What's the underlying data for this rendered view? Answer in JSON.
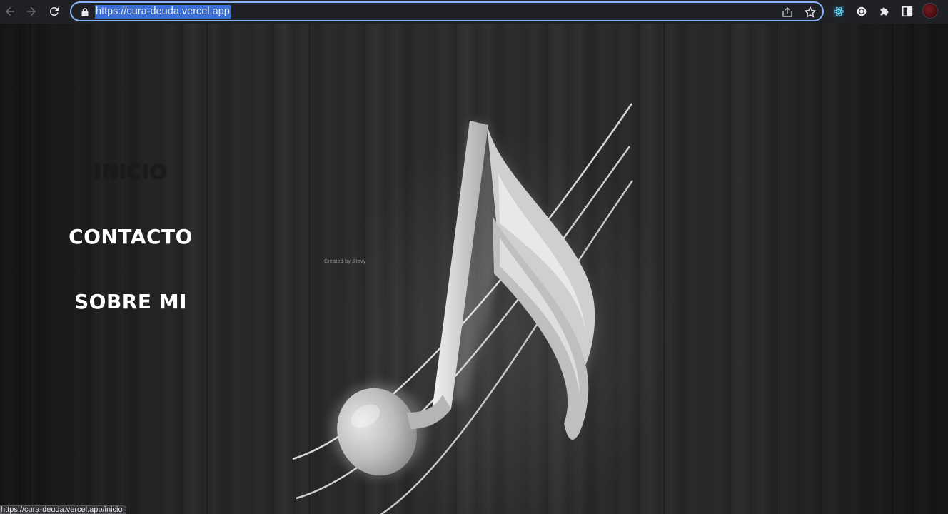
{
  "browser": {
    "url": "https://cura-deuda.vercel.app",
    "status_url": "https://cura-deuda.vercel.app/inicio",
    "accent": "#8ab4f8",
    "icons": [
      "back-icon",
      "forward-icon",
      "reload-icon",
      "lock-icon",
      "share-icon",
      "star-icon",
      "react-devtools-icon",
      "extension-icon",
      "puzzle-icon",
      "side-panel-icon",
      "profile-avatar"
    ]
  },
  "nav": {
    "items": [
      {
        "label": "INICIO",
        "active": true
      },
      {
        "label": "CONTACTO",
        "active": false
      },
      {
        "label": "SOBRE MI",
        "active": false
      }
    ]
  },
  "hero": {
    "credit": "Created by Stevy",
    "art": "music-note-icon"
  }
}
